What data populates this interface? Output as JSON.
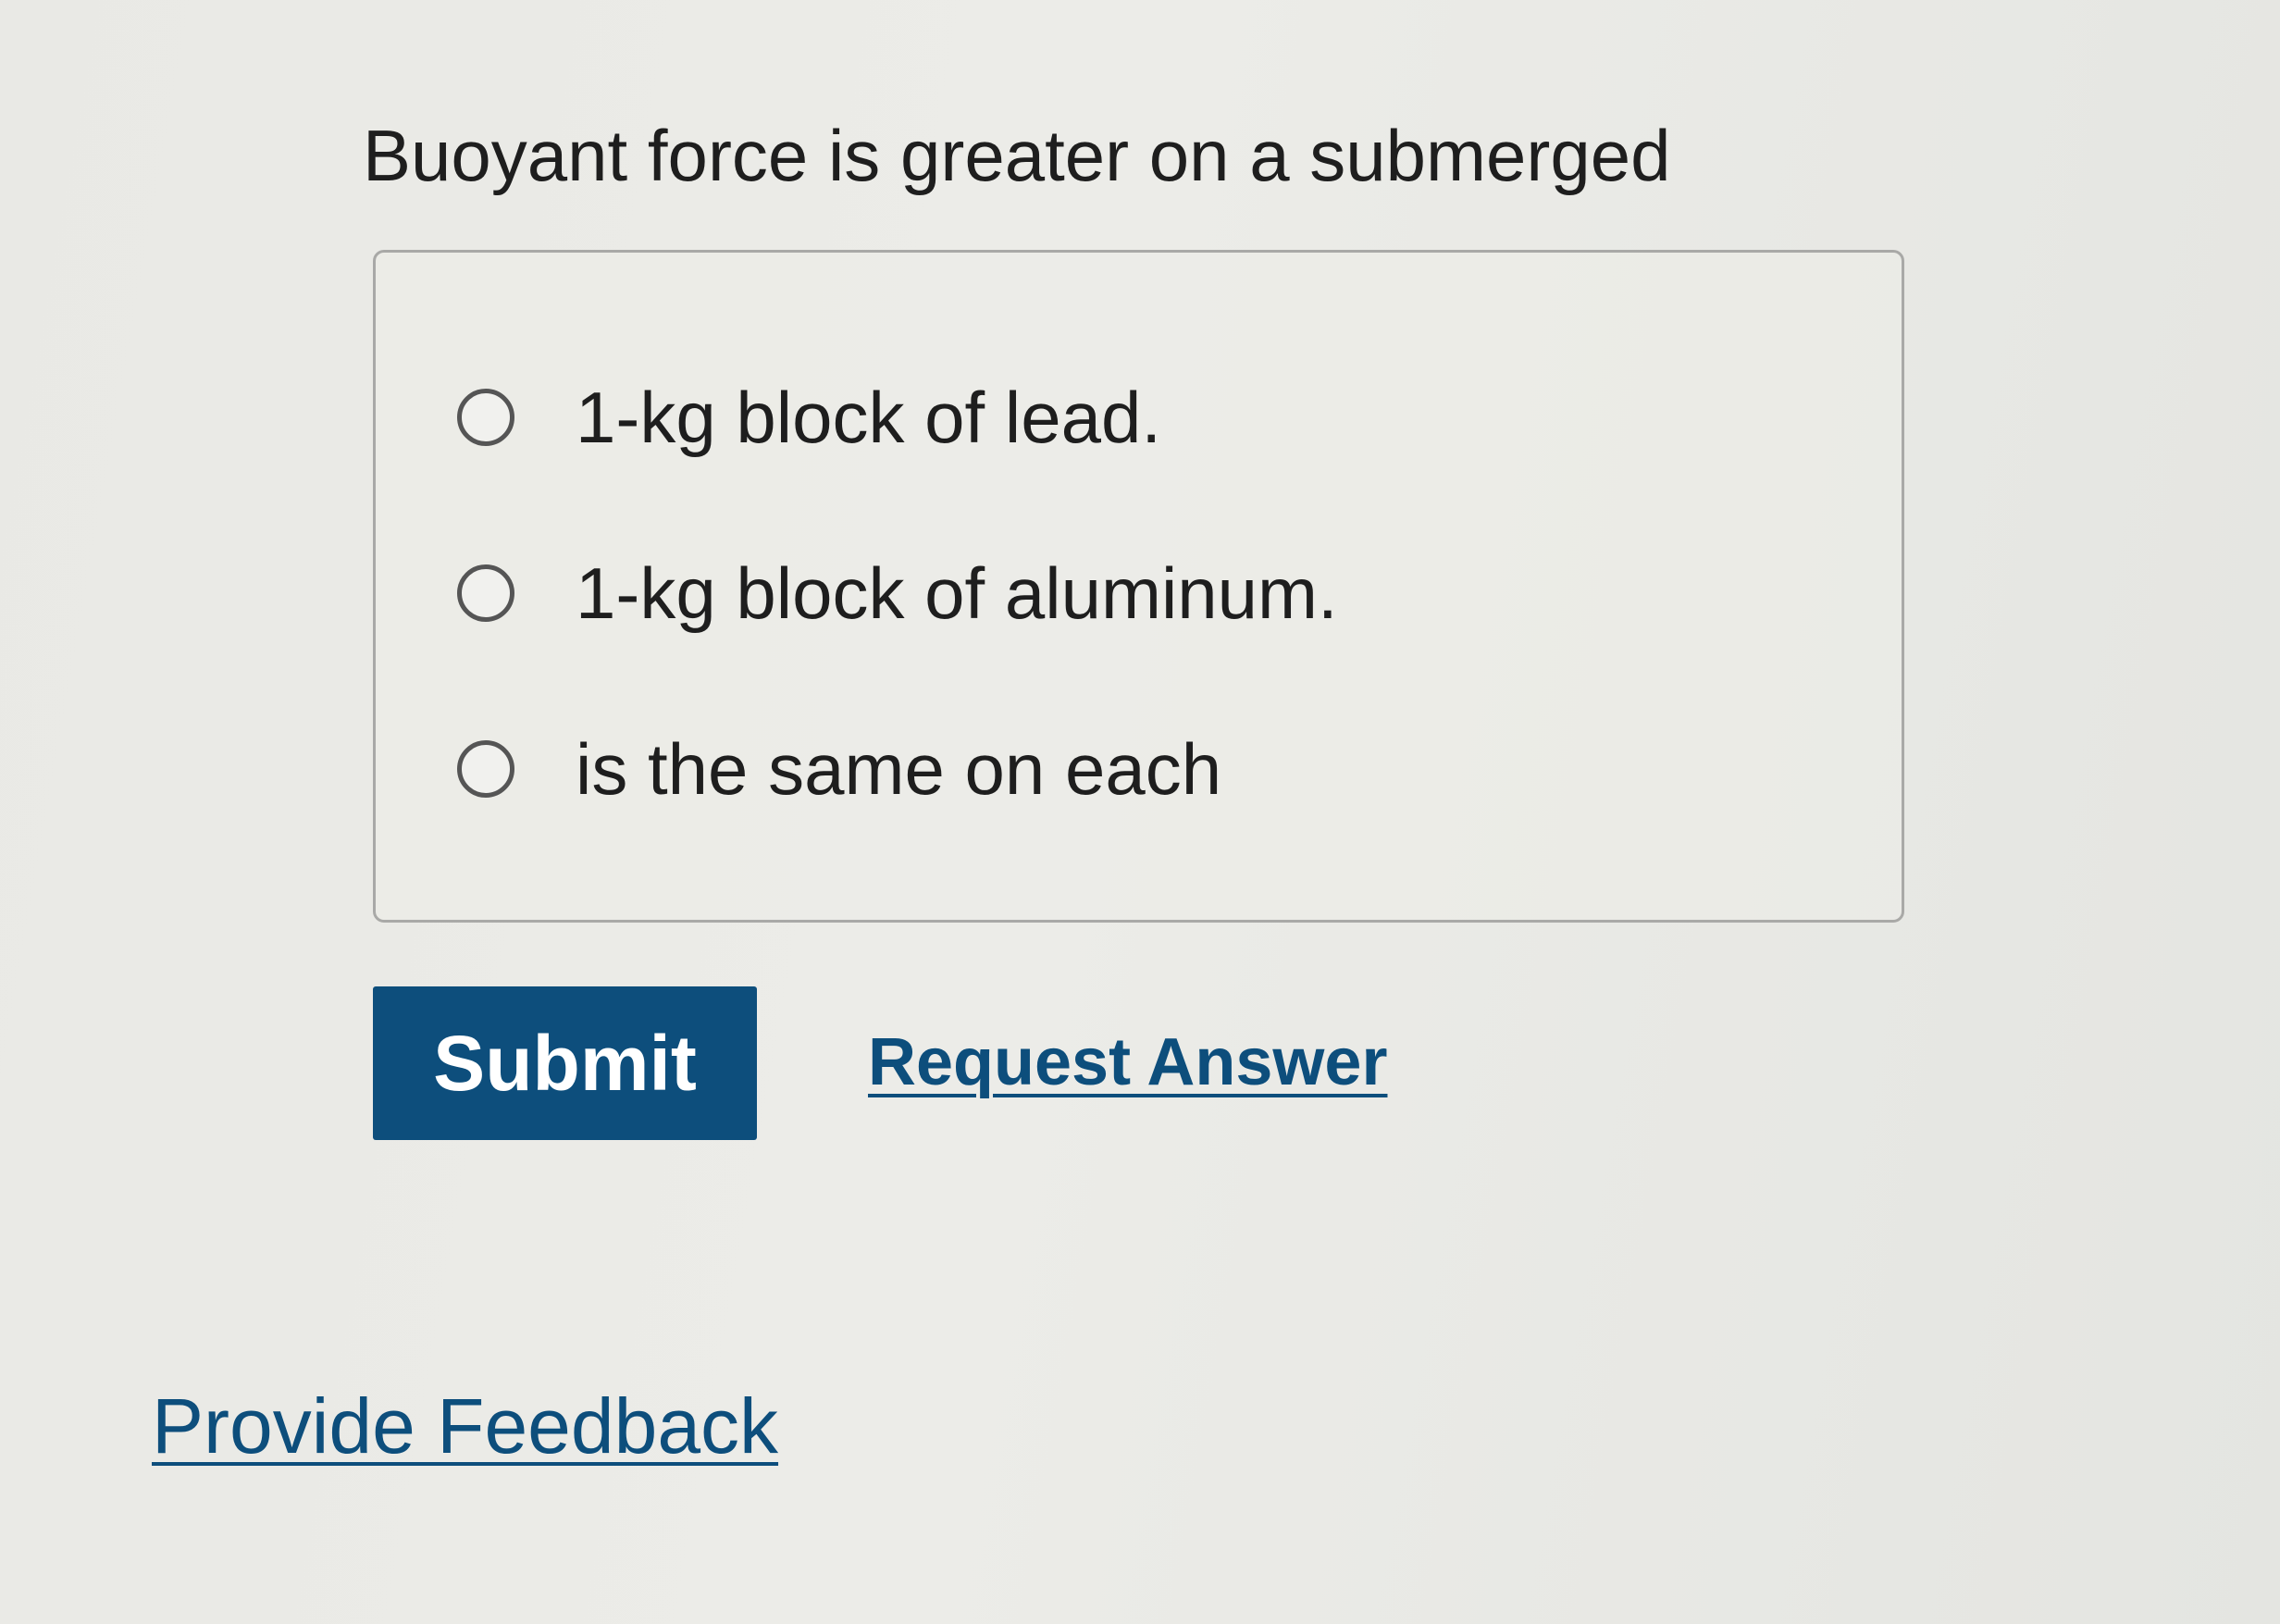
{
  "question": {
    "text": "Buoyant force is greater on a submerged"
  },
  "options": [
    {
      "label": "1-kg block of lead.",
      "selected": false
    },
    {
      "label": "1-kg block of aluminum.",
      "selected": false
    },
    {
      "label": "is the same on each",
      "selected": false
    }
  ],
  "actions": {
    "submit_label": "Submit",
    "request_answer_label": "Request Answer"
  },
  "footer": {
    "feedback_label": "Provide Feedback"
  },
  "colors": {
    "accent": "#0d4e7c",
    "background": "#eaeae6",
    "text": "#1e1e1e"
  }
}
